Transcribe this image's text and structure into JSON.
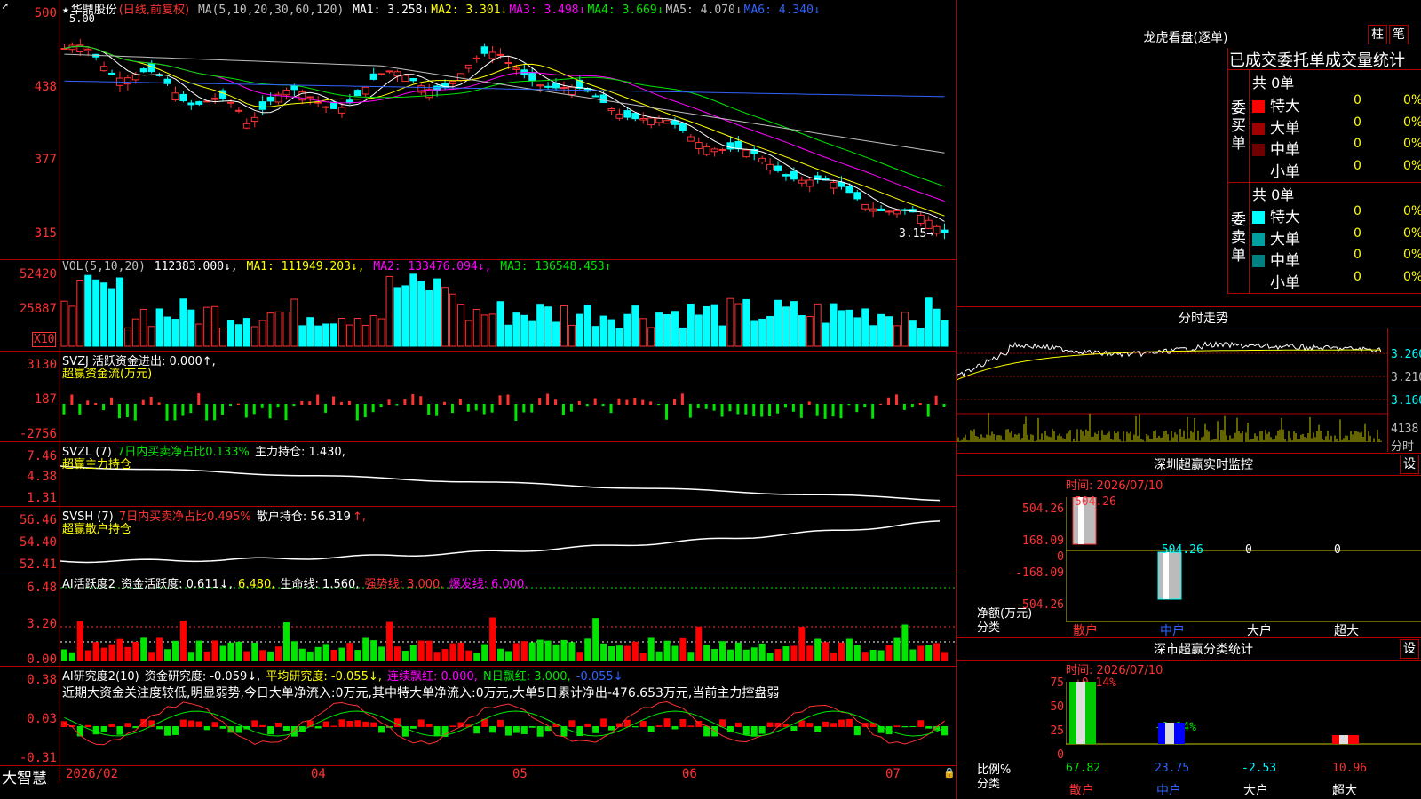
{
  "main": {
    "title": "华鼎股份",
    "period": "(日线,前复权)",
    "ma_label": "MA(5,10,20,30,60,120)",
    "ma": [
      {
        "name": "MA1:",
        "value": "3.258",
        "arrow": "↓",
        "color": "#ffffff"
      },
      {
        "name": "MA2:",
        "value": "3.301",
        "arrow": "↓",
        "color": "#ffff00"
      },
      {
        "name": "MA3:",
        "value": "3.498",
        "arrow": "↓",
        "color": "#ff00ff"
      },
      {
        "name": "MA4:",
        "value": "3.669",
        "arrow": "↓",
        "color": "#00e600"
      },
      {
        "name": "MA5:",
        "value": "4.070",
        "arrow": "↓",
        "color": "#c0c0c0"
      },
      {
        "name": "MA6:",
        "value": "4.340",
        "arrow": "↓",
        "color": "#3264ff"
      }
    ],
    "high_label": "5.00",
    "low_label": "3.15→",
    "y_ticks": [
      "500",
      "438",
      "377",
      "315"
    ]
  },
  "vol": {
    "label": "VOL(5,10,20)",
    "v0": "112383.000↓,",
    "ma1": "MA1: 111949.203↓,",
    "ma2": "MA2: 133476.094↓,",
    "ma3": "MA3: 136548.453↑",
    "y_ticks": [
      "52420",
      "25887"
    ],
    "unit": "X10"
  },
  "svzj": {
    "line1": "SVZJ  活跃资金进出: 0.000↑,",
    "line2": "超赢资金流(万元)",
    "y_ticks": [
      "3130",
      "187",
      "-2756"
    ]
  },
  "svzl": {
    "name": "SVZL (7)",
    "ratio": "7日内买卖净占比0.133%",
    "hold": "主力持仓: 1.430,",
    "line2": "超赢主力持仓",
    "y_ticks": [
      "7.46",
      "4.38",
      "1.31"
    ]
  },
  "svsh": {
    "name": "SVSH (7)",
    "ratio": "7日内买卖净占比0.495%",
    "hold": "散户持仓: 56.319",
    "arrow": "↑,",
    "line2": "超赢散户持仓",
    "y_ticks": [
      "56.46",
      "54.40",
      "52.41"
    ]
  },
  "ai1": {
    "name": "AI活跃度2",
    "a": "资金活跃度: 0.611↓,",
    "b": "6.480,",
    "c": "生命线: 1.560,",
    "d": "强势线: 3.000,",
    "e": "爆发线: 6.000,",
    "y_ticks": [
      "6.48",
      "3.20",
      "0.00"
    ]
  },
  "ai2": {
    "name": "AI研究度2(10)",
    "a": "资金研究度: -0.059↓,",
    "b": "平均研究度: -0.055↓,",
    "c": "连续飘红: 0.000,",
    "d": "N日飘红: 3.000,",
    "e": "-0.055↓",
    "summary": "近期大资金关注度较低,明显弱势,今日大单净流入:0万元,其中特大单净流入:0万元,大单5日累计净出-476.653万元,当前主力控盘弱",
    "y_ticks": [
      "0.38",
      "0.03",
      "-0.31"
    ]
  },
  "bottom": {
    "brand": "大智慧",
    "dates": [
      "2026/02",
      "04",
      "05",
      "06",
      "07"
    ]
  },
  "longhu": {
    "title": "龙虎看盘(逐单)",
    "btn1": "柱",
    "btn2": "笔",
    "subtitle": "已成交委托单成交量统计",
    "buy_label": "委买单",
    "sell_label": "委卖单",
    "buy_total": "共 0单",
    "sell_total": "共 0单",
    "buy_rows": [
      {
        "name": "特大",
        "v": "0",
        "p": "0%",
        "color": "#ff0000"
      },
      {
        "name": "大单",
        "v": "0",
        "p": "0%",
        "color": "#a00000"
      },
      {
        "name": "中单",
        "v": "0",
        "p": "0%",
        "color": "#700000"
      },
      {
        "name": "小单",
        "v": "0",
        "p": "0%",
        "color": ""
      }
    ],
    "sell_rows": [
      {
        "name": "特大",
        "v": "0",
        "p": "0%",
        "color": "#00ffff"
      },
      {
        "name": "大单",
        "v": "0",
        "p": "0%",
        "color": "#00a0a0"
      },
      {
        "name": "中单",
        "v": "0",
        "p": "0%",
        "color": "#008080"
      },
      {
        "name": "小单",
        "v": "0",
        "p": "0%",
        "color": ""
      }
    ]
  },
  "fenshi": {
    "title": "分时走势",
    "y_ticks": [
      "3.260",
      "3.210",
      "3.160"
    ],
    "vol_tick": "4138",
    "vol_label": "分时"
  },
  "sz_monitor": {
    "title": "深圳超赢实时监控",
    "btn": "设",
    "time": "时间: 2026/07/10",
    "y_ticks": [
      "504.26",
      "168.09",
      "0",
      "-168.09",
      "-504.26"
    ],
    "bar_labels": [
      "504.26",
      "-504.26",
      "0",
      "0"
    ],
    "left_label1": "净额(万元)",
    "left_label2": "分类",
    "cats": [
      "散户",
      "中户",
      "大户",
      "超大"
    ]
  },
  "sz_class": {
    "title": "深市超赢分类统计",
    "btn": "设",
    "time": "时间: 2026/07/10",
    "y_ticks": [
      "75",
      "50",
      "25",
      "0"
    ],
    "top_pct": "+0.14%",
    "mid_pct": "-0.14%",
    "values": [
      "67.82",
      "23.75",
      "-2.53",
      "10.96"
    ],
    "left_label1": "比例%",
    "left_label2": "分类",
    "cats": [
      "散户",
      "中户",
      "大户",
      "超大"
    ]
  }
}
